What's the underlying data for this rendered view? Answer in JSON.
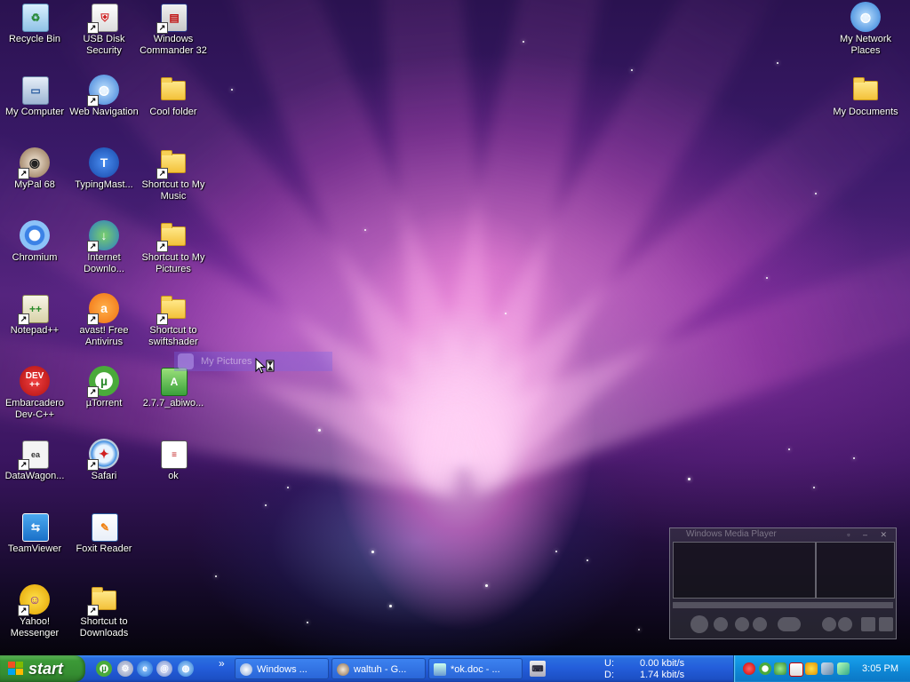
{
  "desktop": {
    "icons": [
      {
        "label": "Recycle Bin"
      },
      {
        "label": "USB Disk Security"
      },
      {
        "label": "Windows Commander 32"
      },
      {
        "label": "My Network Places"
      },
      {
        "label": "My Computer"
      },
      {
        "label": "Web Navigation"
      },
      {
        "label": "Cool folder"
      },
      {
        "label": "My Documents"
      },
      {
        "label": "MyPal 68"
      },
      {
        "label": "TypingMast..."
      },
      {
        "label": "Shortcut to My Music"
      },
      {
        "label": "Chromium"
      },
      {
        "label": "Internet Downlo..."
      },
      {
        "label": "Shortcut to My Pictures"
      },
      {
        "label": "Notepad++"
      },
      {
        "label": "avast! Free Antivirus"
      },
      {
        "label": "Shortcut to swiftshader"
      },
      {
        "label": "Embarcadero Dev-C++"
      },
      {
        "label": "µTorrent"
      },
      {
        "label": "2.7.7_abiwo..."
      },
      {
        "label": "DataWagon..."
      },
      {
        "label": "Safari"
      },
      {
        "label": "ok"
      },
      {
        "label": "TeamViewer"
      },
      {
        "label": "Foxit Reader"
      },
      {
        "label": "Yahoo! Messenger"
      },
      {
        "label": "Shortcut to Downloads"
      }
    ],
    "drag_ghost_label": "My Pictures"
  },
  "media_player": {
    "title": "Windows Media Player"
  },
  "taskbar": {
    "start_label": "start",
    "quick_launch_more": "»",
    "buttons": [
      {
        "label": "Windows ..."
      },
      {
        "label": "waltuh - G..."
      },
      {
        "label": "*ok.doc - ..."
      }
    ],
    "net_meter": {
      "upload_label": "U:",
      "upload_value": "0.00 kbit/s",
      "download_label": "D:",
      "download_value": "1.74 kbit/s"
    },
    "clock": "3:05 PM"
  },
  "colors": {
    "taskbar_blue": "#245edb",
    "start_green": "#3c9a37",
    "tray_blue": "#0f8ad8"
  }
}
